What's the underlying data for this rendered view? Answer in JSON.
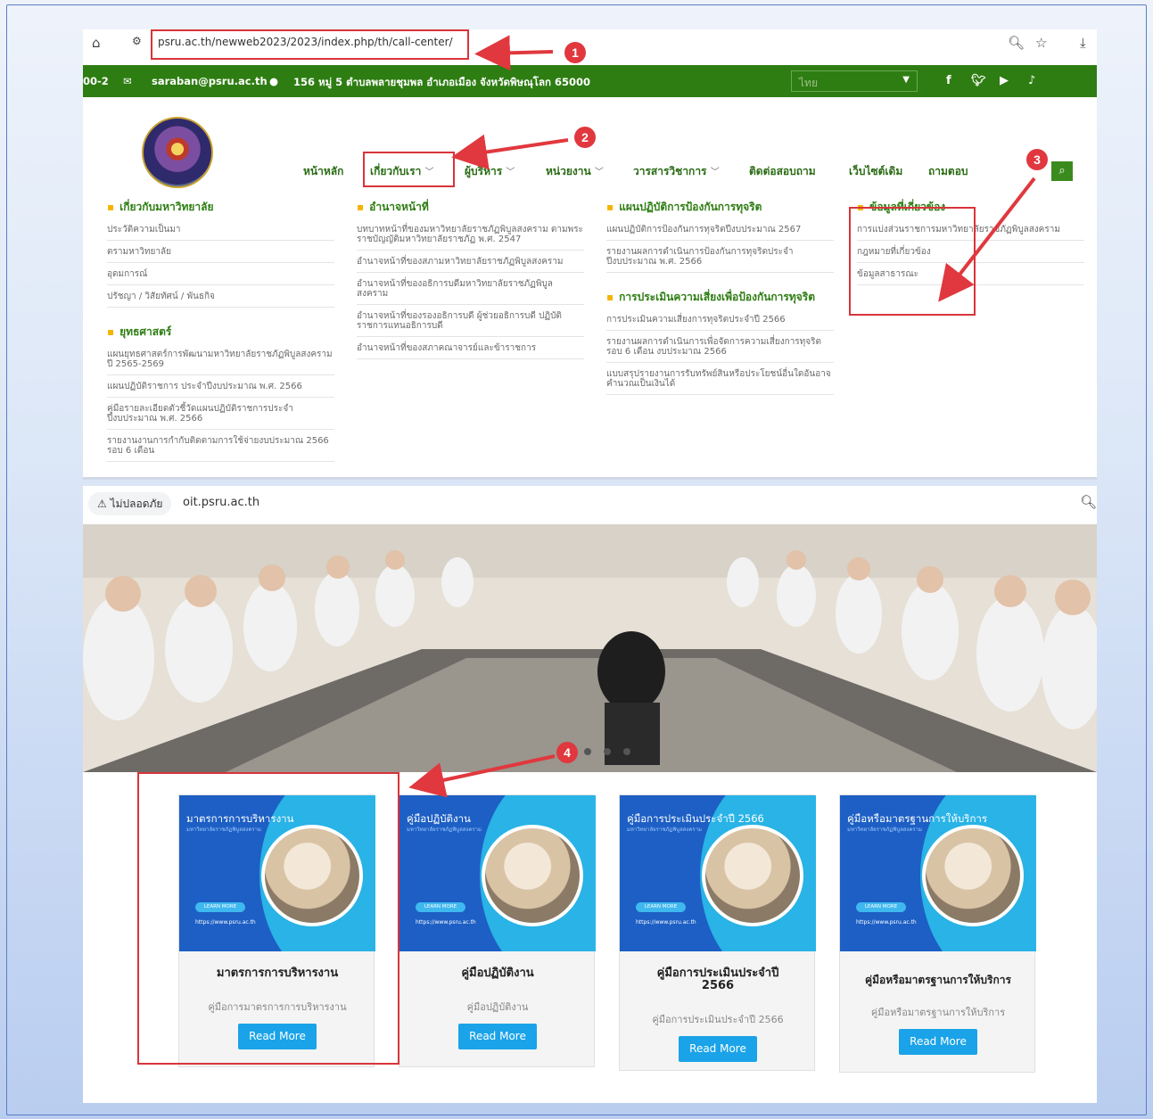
{
  "browser1": {
    "url": "psru.ac.th/newweb2023/2023/index.php/th/call-center/"
  },
  "topbar": {
    "phone_fragment": "00-2",
    "email": "saraban@psru.ac.th",
    "address": "156 หมู่ 5 ตำบลพลายชุมพล อำเภอเมือง จังหวัดพิษณุโลก 65000",
    "language": "ไทย",
    "social_icons": [
      "facebook-icon",
      "twitter-icon",
      "youtube-icon",
      "tiktok-icon"
    ]
  },
  "nav": {
    "items": [
      {
        "label": "หน้าหลัก",
        "has_dropdown": false
      },
      {
        "label": "เกี่ยวกับเรา",
        "has_dropdown": true
      },
      {
        "label": "ผู้บริหาร",
        "has_dropdown": true
      },
      {
        "label": "หน่วยงาน",
        "has_dropdown": true
      },
      {
        "label": "วารสารวิชาการ",
        "has_dropdown": true
      },
      {
        "label": "ติดต่อสอบถาม",
        "has_dropdown": false
      },
      {
        "label": "เว็บไซต์เดิม",
        "has_dropdown": false
      },
      {
        "label": "ถามตอบ",
        "has_dropdown": false
      }
    ]
  },
  "mega": {
    "col1": {
      "heading": "เกี่ยวกับมหาวิทยาลัย",
      "links": [
        "ประวัติความเป็นมา",
        "ตรามหาวิทยาลัย",
        "อุดมการณ์",
        "ปรัชญา / วิสัยทัศน์ / พันธกิจ"
      ],
      "heading2": "ยุทธศาสตร์",
      "links2": [
        "แผนยุทธศาสตร์การพัฒนามหาวิทยาลัยราชภัฏพิบูลสงคราม ปี 2565-2569",
        "แผนปฏิบัติราชการ ประจำปีงบประมาณ พ.ศ. 2566",
        "คู่มือรายละเอียดตัวชี้วัดแผนปฏิบัติราชการประจำปีงบประมาณ พ.ศ. 2566",
        "รายงานงานการกำกับติดตามการใช้จ่ายงบประมาณ 2566 รอบ 6 เดือน"
      ]
    },
    "col2": {
      "heading": "อำนาจหน้าที่",
      "links": [
        "บทบาทหน้าที่ของมหาวิทยาลัยราชภัฏพิบูลสงคราม ตามพระราชบัญญัติมหาวิทยาลัยราชภัฏ พ.ศ. 2547",
        "อำนาจหน้าที่ของสภามหาวิทยาลัยราชภัฏพิบูลสงคราม",
        "อำนาจหน้าที่ของอธิการบดีมหาวิทยาลัยราชภัฏพิบูลสงคราม",
        "อำนาจหน้าที่ของรองอธิการบดี ผู้ช่วยอธิการบดี ปฏิบัติราชการแทนอธิการบดี",
        "อำนาจหน้าที่ของสภาคณาจารย์และข้าราชการ"
      ]
    },
    "col3": {
      "heading": "แผนปฏิบัติการป้องกันการทุจริต",
      "links": [
        "แผนปฏิบัติการป้องกันการทุจริตปีงบประมาณ 2567",
        "รายงานผลการดำเนินการป้องกันการทุจริตประจำปีงบประมาณ พ.ศ. 2566"
      ],
      "heading2": "การประเมินความเสี่ยงเพื่อป้องกันการทุจริต",
      "links2": [
        "การประเมินความเสี่ยงการทุจริตประจำปี 2566",
        "รายงานผลการดำเนินการเพื่อจัดการความเสี่ยงการทุจริตรอบ 6 เดือน งบประมาณ 2566",
        "แบบสรุปรายงานการรับทรัพย์สินหรือประโยชน์อื่นใดอันอาจคำนวณเป็นเงินได้"
      ]
    },
    "col4": {
      "heading": "ข้อมูลที่เกี่ยวข้อง",
      "links": [
        "การแบ่งส่วนราชการมหาวิทยาลัยราชภัฏพิบูลสงคราม",
        "กฎหมายที่เกี่ยวข้อง",
        "ข้อมูลสาธารณะ"
      ]
    }
  },
  "annotations": [
    "1",
    "2",
    "3",
    "4"
  ],
  "browser2": {
    "security_label": "ไม่ปลอดภัย",
    "url": "oit.psru.ac.th"
  },
  "cards": [
    {
      "image_title": "มาตรการการบริหารงาน",
      "image_subtitle": "มหาวิทยาลัยราชภัฏพิบูลสงคราม",
      "learn_more": "LEARN MORE",
      "site": "https://www.psru.ac.th",
      "title": "มาตรการการบริหารงาน",
      "desc": "คู่มือการมาตรการการบริหารงาน",
      "button": "Read More"
    },
    {
      "image_title": "คู่มือปฏิบัติงาน",
      "image_subtitle": "มหาวิทยาลัยราชภัฏพิบูลสงคราม",
      "learn_more": "LEARN MORE",
      "site": "https://www.psru.ac.th",
      "title": "คู่มือปฏิบัติงาน",
      "desc": "คู่มือปฏิบัติงาน",
      "button": "Read More"
    },
    {
      "image_title": "คู่มือการประเมินประจำปี 2566",
      "image_subtitle": "มหาวิทยาลัยราชภัฏพิบูลสงคราม",
      "learn_more": "LEARN MORE",
      "site": "https://www.psru.ac.th",
      "title": "คู่มือการประเมินประจำปี 2566",
      "desc": "คู่มือการประเมินประจำปี 2566",
      "button": "Read More"
    },
    {
      "image_title": "คู่มือหรือมาตรฐานการให้บริการ",
      "image_subtitle": "มหาวิทยาลัยราชภัฏพิบูลสงคราม",
      "learn_more": "LEARN MORE",
      "site": "https://www.psru.ac.th",
      "title": "คู่มือหรือมาตรฐานการให้บริการ",
      "desc": "คู่มือหรือมาตรฐานการให้บริการ",
      "button": "Read More"
    }
  ],
  "colors": {
    "green": "#2e7d12",
    "annotation_red": "#d9343a",
    "button_blue": "#1aa3e8",
    "card_blue": "#1d5fc4"
  }
}
